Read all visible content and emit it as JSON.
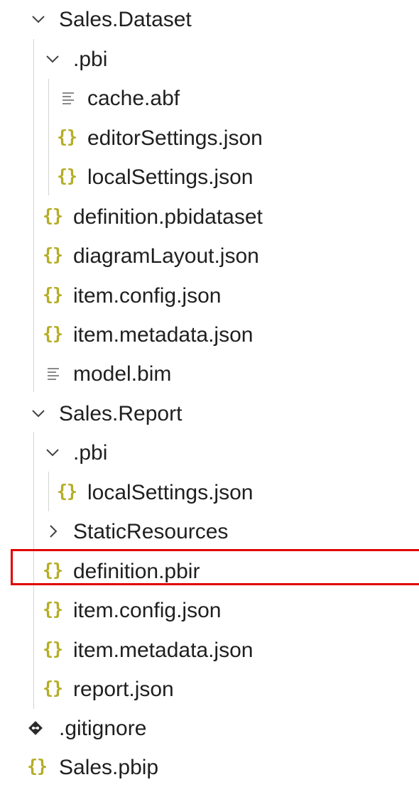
{
  "explorer": {
    "items": [
      {
        "label": "Sales.Dataset",
        "kind": "folder-open"
      },
      {
        "label": ".pbi",
        "kind": "folder-open"
      },
      {
        "label": "cache.abf",
        "kind": "text-file",
        "icon": "lines-icon"
      },
      {
        "label": "editorSettings.json",
        "kind": "json-file",
        "icon": "json-braces-icon"
      },
      {
        "label": "localSettings.json",
        "kind": "json-file",
        "icon": "json-braces-icon"
      },
      {
        "label": "definition.pbidataset",
        "kind": "json-file",
        "icon": "json-braces-icon"
      },
      {
        "label": "diagramLayout.json",
        "kind": "json-file",
        "icon": "json-braces-icon"
      },
      {
        "label": "item.config.json",
        "kind": "json-file",
        "icon": "json-braces-icon"
      },
      {
        "label": "item.metadata.json",
        "kind": "json-file",
        "icon": "json-braces-icon"
      },
      {
        "label": "model.bim",
        "kind": "text-file",
        "icon": "lines-icon"
      },
      {
        "label": "Sales.Report",
        "kind": "folder-open"
      },
      {
        "label": ".pbi",
        "kind": "folder-open"
      },
      {
        "label": "localSettings.json",
        "kind": "json-file",
        "icon": "json-braces-icon"
      },
      {
        "label": "StaticResources",
        "kind": "folder-closed"
      },
      {
        "label": "definition.pbir",
        "kind": "json-file",
        "icon": "json-braces-icon",
        "highlighted": true
      },
      {
        "label": "item.config.json",
        "kind": "json-file",
        "icon": "json-braces-icon"
      },
      {
        "label": "item.metadata.json",
        "kind": "json-file",
        "icon": "json-braces-icon"
      },
      {
        "label": "report.json",
        "kind": "json-file",
        "icon": "json-braces-icon"
      },
      {
        "label": ".gitignore",
        "kind": "git-file",
        "icon": "git-icon"
      },
      {
        "label": "Sales.pbip",
        "kind": "json-file",
        "icon": "json-braces-icon"
      }
    ]
  },
  "icons": {
    "json_braces": "{}"
  },
  "colors": {
    "json_icon": "#b5ad26",
    "highlight_border": "#e00000",
    "guide_line": "#d4d4d4"
  }
}
